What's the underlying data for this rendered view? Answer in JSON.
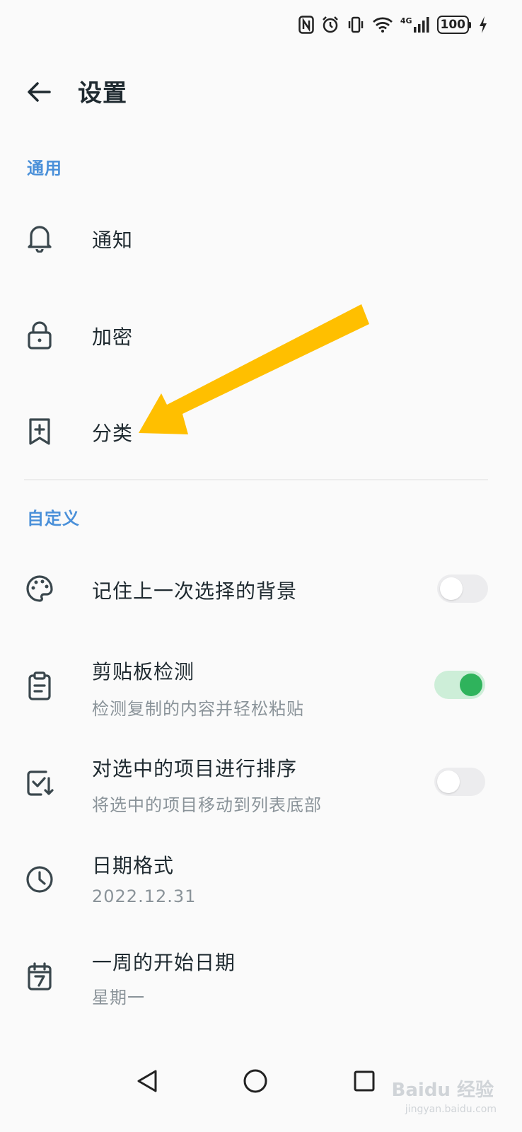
{
  "status_bar": {
    "network_label": "4G",
    "battery": "100"
  },
  "header": {
    "title": "设置"
  },
  "sections": {
    "general": {
      "title": "通用",
      "items": [
        {
          "label": "通知",
          "icon": "bell-icon"
        },
        {
          "label": "加密",
          "icon": "lock-icon"
        },
        {
          "label": "分类",
          "icon": "bookmark-add-icon"
        }
      ]
    },
    "custom": {
      "title": "自定义",
      "items": [
        {
          "label": "记住上一次选择的背景",
          "icon": "palette-icon",
          "toggle": false
        },
        {
          "label": "剪贴板检测",
          "sub": "检测复制的内容并轻松粘贴",
          "icon": "clipboard-icon",
          "toggle": true
        },
        {
          "label": "对选中的项目进行排序",
          "sub": "将选中的项目移动到列表底部",
          "icon": "checkbox-sort-icon",
          "toggle": false
        },
        {
          "label": "日期格式",
          "sub": "2022.12.31",
          "icon": "clock-icon"
        },
        {
          "label": "一周的开始日期",
          "sub": "星期一",
          "icon": "calendar-icon"
        }
      ]
    }
  },
  "watermark": {
    "brand": "Baidu 经验",
    "url": "jingyan.baidu.com"
  },
  "colors": {
    "accent": "#4a90d9",
    "toggle_on": "#2fb35c",
    "annotation_arrow": "#ffbf00"
  }
}
